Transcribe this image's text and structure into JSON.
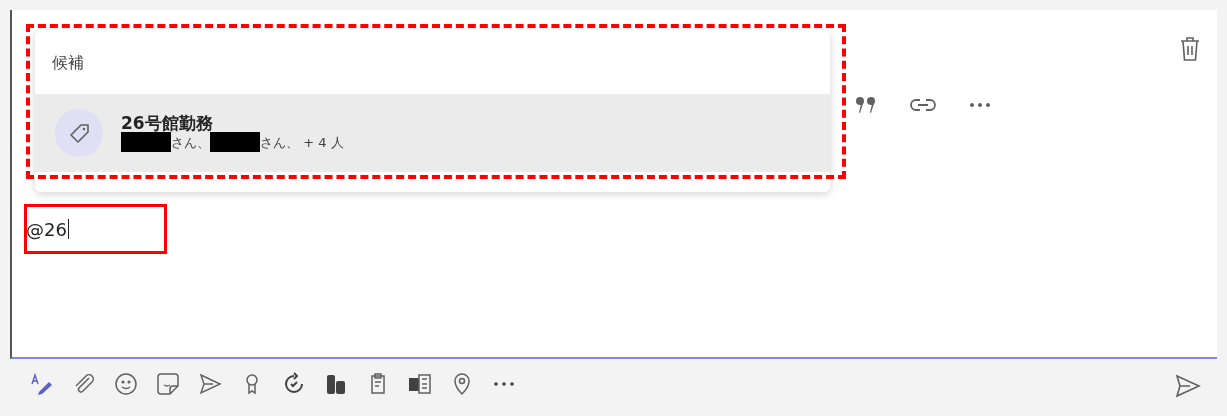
{
  "compose": {
    "typed_text": "@26"
  },
  "suggestions": {
    "header": "候補",
    "items": [
      {
        "title": "26号館勤務",
        "member_parts": [
          {
            "redacted": true,
            "text": "さん、"
          },
          {
            "redacted": true,
            "text": "さん、 + 4 人"
          }
        ],
        "selected": true
      }
    ]
  },
  "annotations": [
    {
      "kind": "dashed"
    },
    {
      "kind": "solid"
    }
  ]
}
